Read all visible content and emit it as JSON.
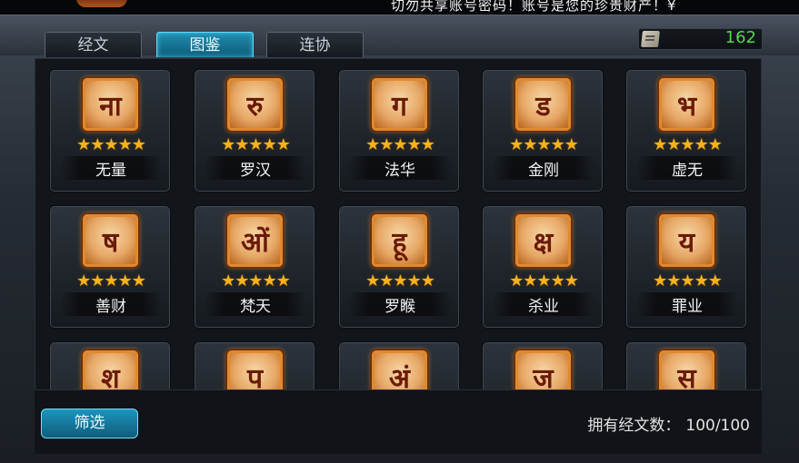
{
  "marquee_text": "切勿共享账号密码！账号是您的珍贵财产！¥",
  "tabs": [
    {
      "label": "经文",
      "active": false
    },
    {
      "label": "图鉴",
      "active": true
    },
    {
      "label": "连协",
      "active": false
    }
  ],
  "counter": {
    "icon": "scroll-icon",
    "value": "162"
  },
  "cards": [
    {
      "name": "无量",
      "glyph": "ना",
      "stars": 5
    },
    {
      "name": "罗汉",
      "glyph": "रु",
      "stars": 5
    },
    {
      "name": "法华",
      "glyph": "ग",
      "stars": 5
    },
    {
      "name": "金刚",
      "glyph": "ड",
      "stars": 5
    },
    {
      "name": "虚无",
      "glyph": "भ",
      "stars": 5
    },
    {
      "name": "善财",
      "glyph": "ष",
      "stars": 5
    },
    {
      "name": "梵天",
      "glyph": "ओं",
      "stars": 5
    },
    {
      "name": "罗睺",
      "glyph": "हू",
      "stars": 5
    },
    {
      "name": "杀业",
      "glyph": "क्ष",
      "stars": 5
    },
    {
      "name": "罪业",
      "glyph": "य",
      "stars": 5
    },
    {
      "name": "",
      "glyph": "श",
      "stars": 0
    },
    {
      "name": "",
      "glyph": "प",
      "stars": 0
    },
    {
      "name": "",
      "glyph": "अं",
      "stars": 0
    },
    {
      "name": "",
      "glyph": "ज",
      "stars": 0
    },
    {
      "name": "",
      "glyph": "स",
      "stars": 0
    }
  ],
  "filter_label": "筛选",
  "owned": {
    "label": "拥有经文数：",
    "value": "100/100"
  },
  "colors": {
    "accent_cyan": "#1f8db0",
    "star": "#f6b21b",
    "counter_green": "#52d84c",
    "glyph_border": "#e08a2d"
  }
}
